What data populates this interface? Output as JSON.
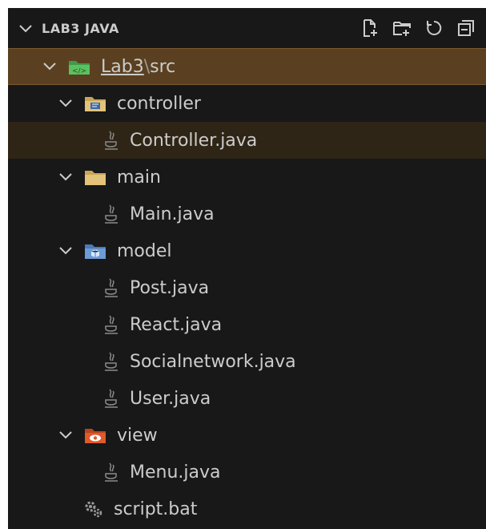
{
  "explorer": {
    "title": "LAB3 JAVA",
    "actions": [
      "new-file-icon",
      "new-folder-icon",
      "refresh-icon",
      "collapse-all-icon"
    ]
  },
  "tree": {
    "root": {
      "project": "Lab3",
      "separator": "\\",
      "folder": "src"
    },
    "controller": {
      "label": "controller",
      "files": [
        "Controller.java"
      ]
    },
    "main": {
      "label": "main",
      "files": [
        "Main.java"
      ]
    },
    "model": {
      "label": "model",
      "files": [
        "Post.java",
        "React.java",
        "Socialnetwork.java",
        "User.java"
      ]
    },
    "view": {
      "label": "view",
      "files": [
        "Menu.java"
      ]
    },
    "script": {
      "label": "script.bat"
    }
  },
  "colors": {
    "background": "#181818",
    "selected_row": "#5a4020",
    "text": "#cccccc",
    "project_icon": "#4caf50",
    "java_icon": "#8a8a8a",
    "folder": "#d9b66b",
    "view_icon": "#e05a2b"
  }
}
